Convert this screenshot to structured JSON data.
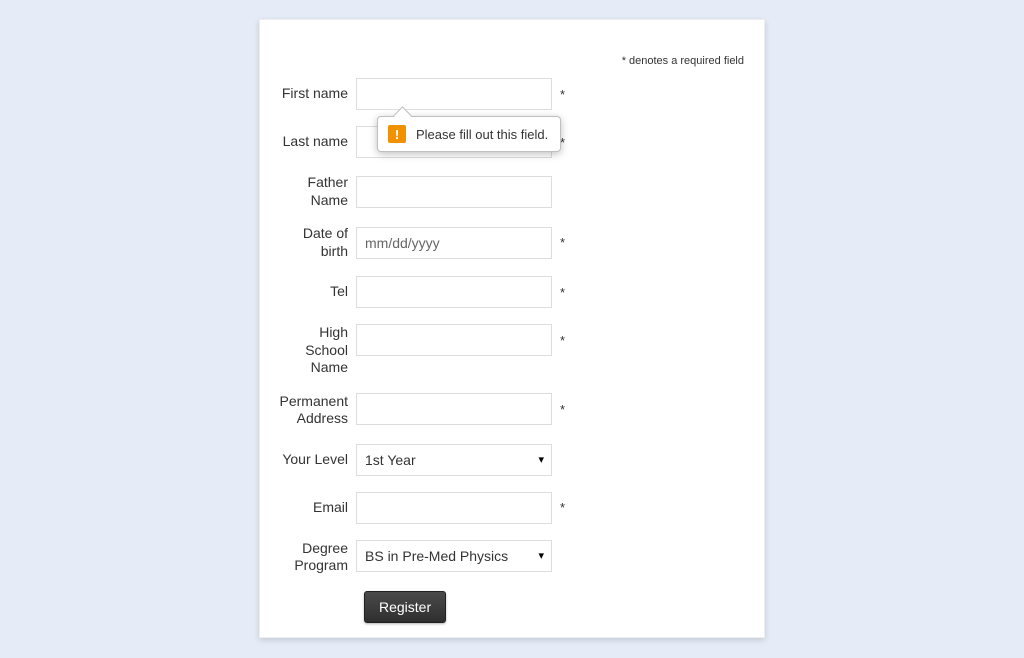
{
  "required_note": "* denotes a required field",
  "labels": {
    "first_name": "First name",
    "last_name": "Last name",
    "father_name": "Father Name",
    "dob": "Date of birth",
    "tel": "Tel",
    "high_school": "High School Name",
    "address": "Permanent Address",
    "level": "Your Level",
    "email": "Email",
    "degree": "Degree Program"
  },
  "values": {
    "first_name": "",
    "last_name": "",
    "father_name": "",
    "dob_placeholder": "mm/dd/yyyy",
    "dob": "",
    "tel": "",
    "high_school": "",
    "address": "",
    "level": "1st Year",
    "email": "",
    "degree": "BS in Pre-Med Physics"
  },
  "star": "*",
  "button": {
    "register": "Register"
  },
  "tooltip": {
    "message": "Please fill out this field."
  }
}
